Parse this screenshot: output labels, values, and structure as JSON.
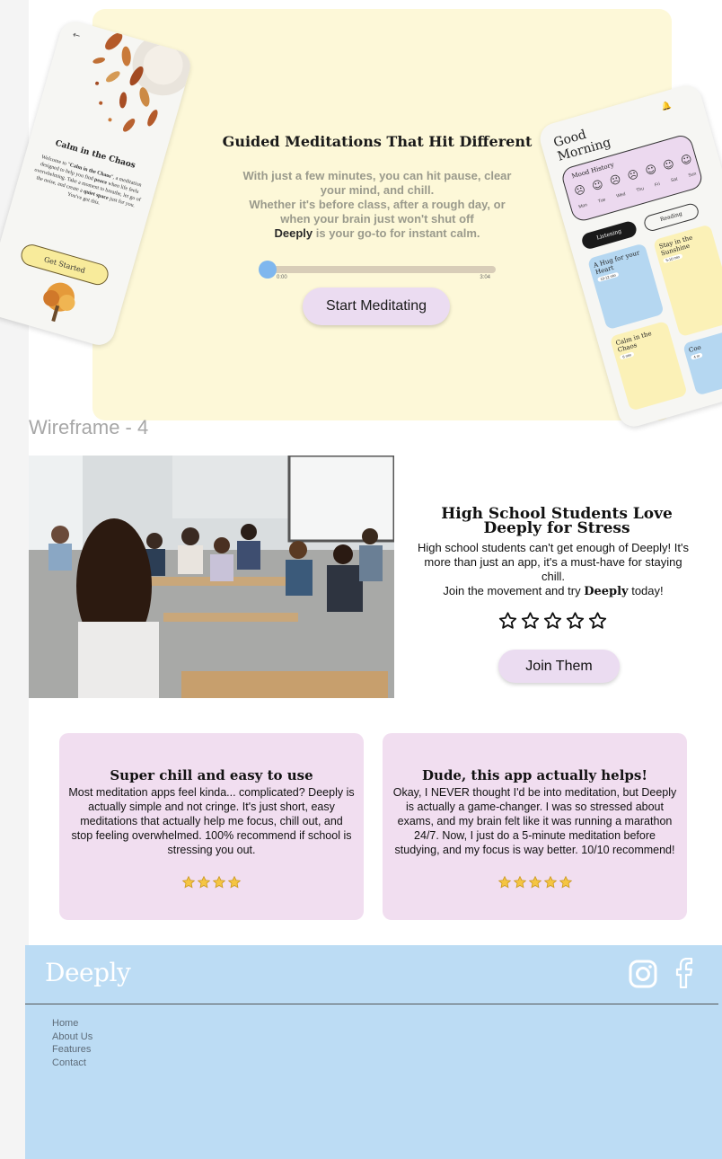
{
  "hero": {
    "title": "Guided Meditations That Hit Different",
    "text_line1": "With just a few minutes, you can hit pause, clear your mind, and chill.",
    "text_line2": "Whether it's before class, after a rough day, or when your brain just won't shut off",
    "brand": "Deeply",
    "text_line3": " is your go-to for instant calm.",
    "audio": {
      "current": "0:00",
      "duration": "3:04",
      "progress": 0
    },
    "start_label": "Start Meditating"
  },
  "phone_left": {
    "back": "←",
    "title": "Calm in the Chaos",
    "body_1": "Welcome to \"",
    "body_bold_1": "Calm in the Chaos",
    "body_2": "\", a meditation designed to help you find ",
    "body_bold_2": "peace",
    "body_3": " when life feels overwhelming. Take a moment to breathe, let go of the noise, and create a ",
    "body_bold_3": "quiet space",
    "body_4": " just for you. You've got this.",
    "button": "Get Started"
  },
  "phone_right": {
    "greeting": "Good Morning",
    "mood_title": "Mood History",
    "days": [
      "Mon",
      "Tue",
      "Wed",
      "Thu",
      "Fri",
      "Sat",
      "Sun"
    ],
    "tab_active": "Listening",
    "tab_inactive": "Reading",
    "cards": [
      {
        "title": "A Hug for your Heart",
        "duration": "10-12 min"
      },
      {
        "title": "Stay in the Sunshine",
        "duration": "5-10 min"
      },
      {
        "title": "Calm in the Chaos",
        "duration": "6 min"
      },
      {
        "title": "Coo",
        "duration": "4 m"
      }
    ]
  },
  "wireframe_label": "Wireframe - 4",
  "students": {
    "title": "High School Students Love Deeply for Stress",
    "text_1": "High school students can't get enough of Deeply! It's more than just an app, it's a must-have for staying chill.",
    "text_2": "Join the movement and try ",
    "brand": "Deeply",
    "text_3": " today!",
    "rating": 0,
    "rating_max": 5,
    "join_label": "Join Them"
  },
  "reviews": [
    {
      "title": "Super chill and easy to use",
      "body": "Most meditation apps feel kinda... complicated? Deeply is actually simple and not cringe. It's just short, easy meditations that actually help me focus, chill out, and stop feeling overwhelmed. 100% recommend if school is stressing you out.",
      "stars": 4
    },
    {
      "title": "Dude, this app actually helps!",
      "body": "Okay, I NEVER thought I'd be into meditation, but Deeply is actually a game-changer. I was so stressed about exams, and my brain felt like it was running a marathon 24/7. Now, I just do a 5-minute meditation before studying, and my focus is way better. 10/10 recommend!",
      "stars": 5
    }
  ],
  "footer": {
    "logo": "Deeply",
    "nav": [
      "Home",
      "About Us",
      "Features",
      "Contact"
    ]
  },
  "colors": {
    "hero_bg": "#fdf8d8",
    "button_bg": "#ebdcf1",
    "review_bg": "#f1def0",
    "footer_bg": "#bcdcf4",
    "progress_knob": "#7fb7ee",
    "star_fill": "#f5c542"
  }
}
